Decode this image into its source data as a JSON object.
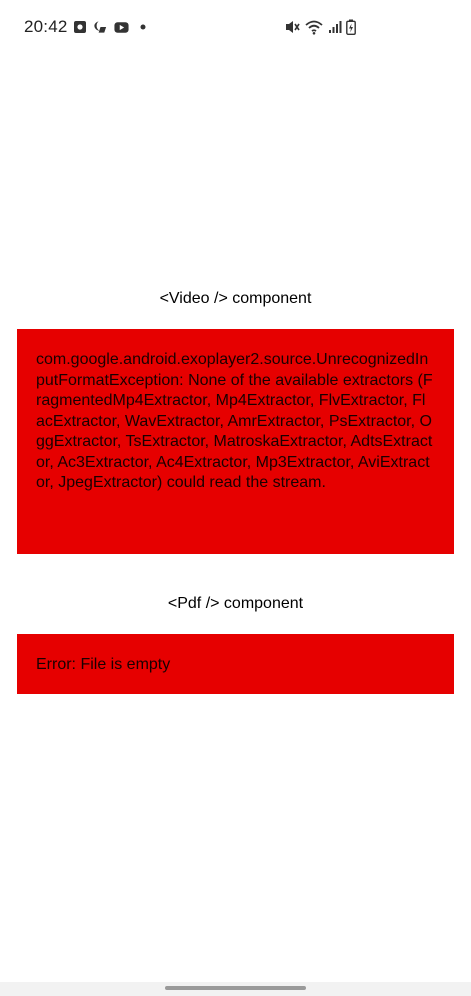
{
  "status_bar": {
    "time": "20:42",
    "left_icons": [
      "screenshot-icon",
      "moon-person-icon",
      "youtube-icon",
      "dot-icon"
    ],
    "right_icons": [
      "vibrate-mute-icon",
      "wifi-icon",
      "signal-icon",
      "battery-icon"
    ]
  },
  "video_section": {
    "title": "<Video /> component",
    "error_message": "com.google.android.exoplayer2.source.UnrecognizedInputFormatException: None of the available extractors (FragmentedMp4Extractor, Mp4Extractor, FlvExtractor, FlacExtractor, WavExtractor, AmrExtractor, PsExtractor, OggExtractor, TsExtractor, MatroskaExtractor, AdtsExtractor, Ac3Extractor, Ac4Extractor, Mp3Extractor, AviExtractor, JpegExtractor) could read the stream."
  },
  "pdf_section": {
    "title": "<Pdf /> component",
    "error_message": "Error: File is empty"
  },
  "colors": {
    "error_background": "#e60000",
    "background": "#ffffff"
  }
}
